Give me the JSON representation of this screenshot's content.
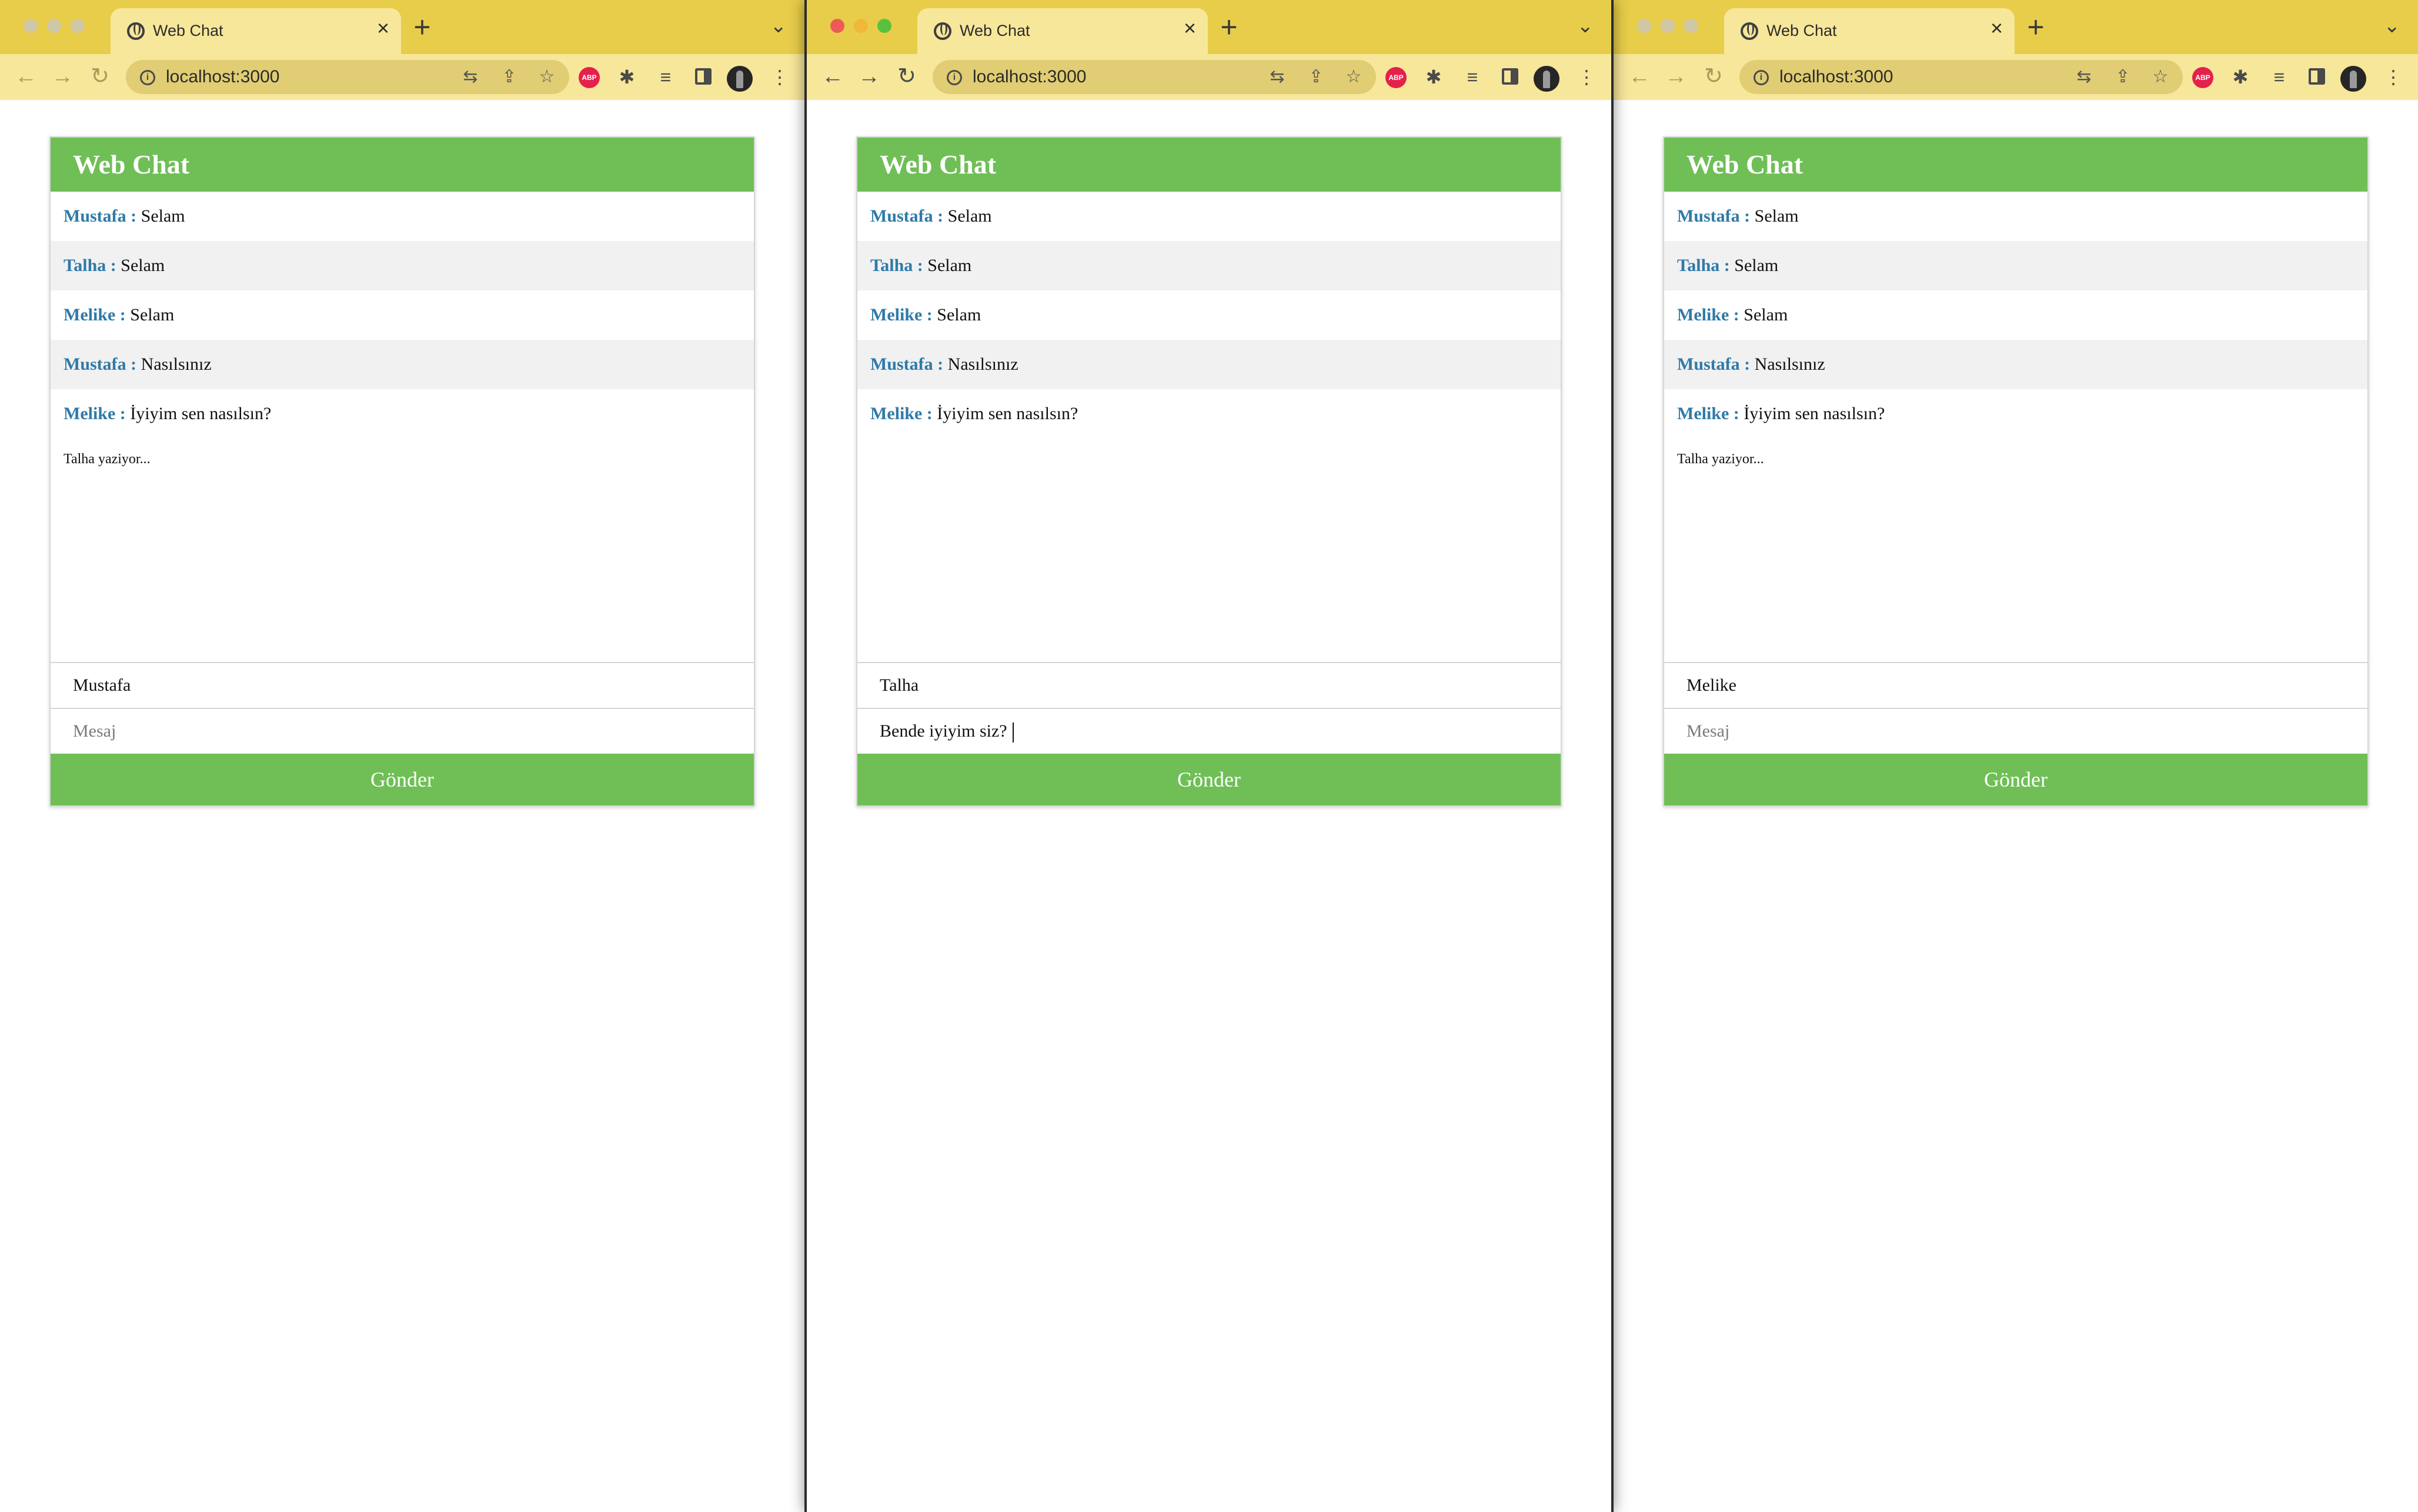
{
  "colors": {
    "tabbar": "#e8cd4a",
    "toolbar": "#f7e79a",
    "accent_green": "#6fbf56",
    "author_blue": "#2f7aa8",
    "abp_red": "#e4214b"
  },
  "windows": [
    {
      "active": false,
      "tab_title": "Web Chat",
      "url": "localhost:3000",
      "chat_title": "Web Chat",
      "messages": [
        {
          "author": "Mustafa :",
          "text": " Selam"
        },
        {
          "author": "Talha :",
          "text": " Selam"
        },
        {
          "author": "Melike :",
          "text": " Selam"
        },
        {
          "author": "Mustafa :",
          "text": " Nasılsınız"
        },
        {
          "author": "Melike :",
          "text": " İyiyim sen nasılsın?"
        }
      ],
      "typing_indicator": "Talha yaziyor...",
      "name_value": "Mustafa",
      "message_value": "",
      "message_placeholder": "Mesaj",
      "send_label": "Gönder"
    },
    {
      "active": true,
      "tab_title": "Web Chat",
      "url": "localhost:3000",
      "chat_title": "Web Chat",
      "messages": [
        {
          "author": "Mustafa :",
          "text": " Selam"
        },
        {
          "author": "Talha :",
          "text": " Selam"
        },
        {
          "author": "Melike :",
          "text": " Selam"
        },
        {
          "author": "Mustafa :",
          "text": " Nasılsınız"
        },
        {
          "author": "Melike :",
          "text": " İyiyim sen nasılsın?"
        }
      ],
      "typing_indicator": "",
      "name_value": "Talha",
      "message_value": "Bende iyiyim siz?",
      "message_placeholder": "Mesaj",
      "send_label": "Gönder"
    },
    {
      "active": false,
      "tab_title": "Web Chat",
      "url": "localhost:3000",
      "chat_title": "Web Chat",
      "messages": [
        {
          "author": "Mustafa :",
          "text": " Selam"
        },
        {
          "author": "Talha :",
          "text": " Selam"
        },
        {
          "author": "Melike :",
          "text": " Selam"
        },
        {
          "author": "Mustafa :",
          "text": " Nasılsınız"
        },
        {
          "author": "Melike :",
          "text": " İyiyim sen nasılsın?"
        }
      ],
      "typing_indicator": "Talha yaziyor...",
      "name_value": "Melike",
      "message_value": "",
      "message_placeholder": "Mesaj",
      "send_label": "Gönder"
    }
  ]
}
